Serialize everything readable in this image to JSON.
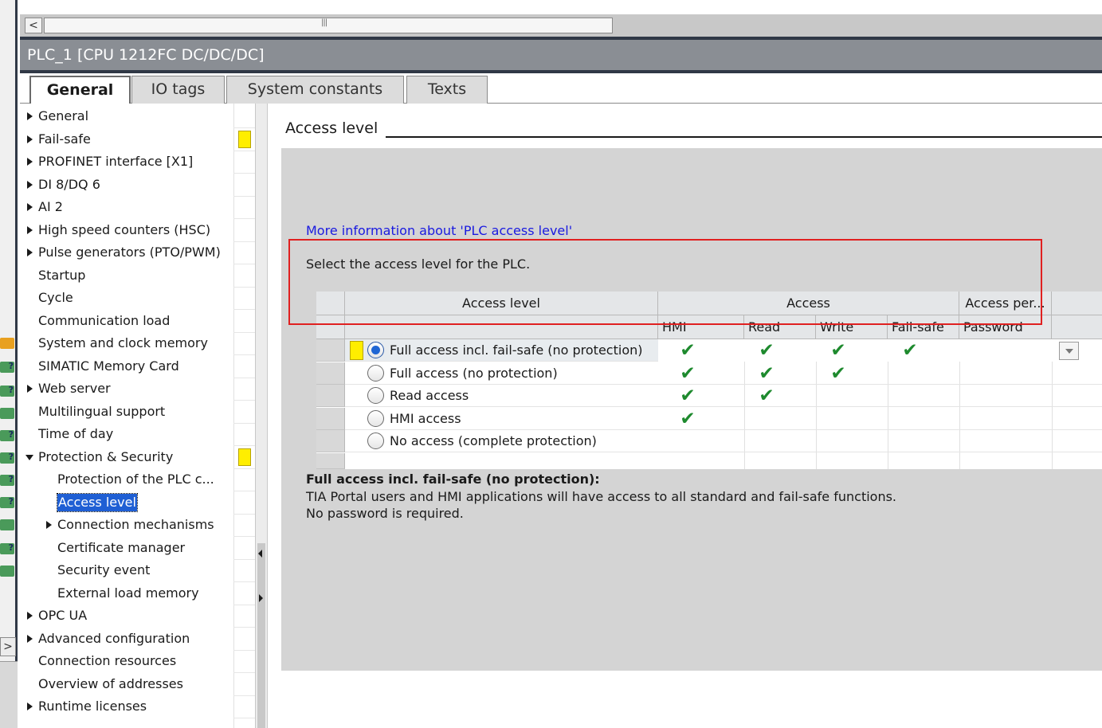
{
  "window": {
    "title": "PLC_1 [CPU 1212FC DC/DC/DC]"
  },
  "tabs": [
    {
      "label": "General",
      "active": true
    },
    {
      "label": "IO tags",
      "active": false
    },
    {
      "label": "System constants",
      "active": false
    },
    {
      "label": "Texts",
      "active": false
    }
  ],
  "nav": {
    "items": [
      {
        "label": "General",
        "indent": 0,
        "expander": "right"
      },
      {
        "label": "Fail-safe",
        "indent": 0,
        "expander": "right",
        "flag": true
      },
      {
        "label": "PROFINET interface [X1]",
        "indent": 0,
        "expander": "right"
      },
      {
        "label": "DI 8/DQ 6",
        "indent": 0,
        "expander": "right"
      },
      {
        "label": "AI 2",
        "indent": 0,
        "expander": "right"
      },
      {
        "label": "High speed counters (HSC)",
        "indent": 0,
        "expander": "right"
      },
      {
        "label": "Pulse generators (PTO/PWM)",
        "indent": 0,
        "expander": "right"
      },
      {
        "label": "Startup",
        "indent": 0,
        "expander": "none"
      },
      {
        "label": "Cycle",
        "indent": 0,
        "expander": "none"
      },
      {
        "label": "Communication load",
        "indent": 0,
        "expander": "none"
      },
      {
        "label": "System and clock memory",
        "indent": 0,
        "expander": "none"
      },
      {
        "label": "SIMATIC Memory Card",
        "indent": 0,
        "expander": "none"
      },
      {
        "label": "Web server",
        "indent": 0,
        "expander": "right"
      },
      {
        "label": "Multilingual support",
        "indent": 0,
        "expander": "none"
      },
      {
        "label": "Time of day",
        "indent": 0,
        "expander": "none"
      },
      {
        "label": "Protection & Security",
        "indent": 0,
        "expander": "down",
        "flag": true
      },
      {
        "label": "Protection of the PLC c...",
        "indent": 1,
        "expander": "none"
      },
      {
        "label": "Access level",
        "indent": 1,
        "expander": "none",
        "selected": true
      },
      {
        "label": "Connection mechanisms",
        "indent": 1,
        "expander": "right"
      },
      {
        "label": "Certificate manager",
        "indent": 1,
        "expander": "none"
      },
      {
        "label": "Security event",
        "indent": 1,
        "expander": "none"
      },
      {
        "label": "External load memory",
        "indent": 1,
        "expander": "none"
      },
      {
        "label": "OPC UA",
        "indent": 0,
        "expander": "right"
      },
      {
        "label": "Advanced configuration",
        "indent": 0,
        "expander": "right"
      },
      {
        "label": "Connection resources",
        "indent": 0,
        "expander": "none"
      },
      {
        "label": "Overview of addresses",
        "indent": 0,
        "expander": "none"
      },
      {
        "label": "Runtime licenses",
        "indent": 0,
        "expander": "right"
      }
    ]
  },
  "content": {
    "section_title": "Access level",
    "info_link": "More information about 'PLC access level'",
    "instruction": "Select the access level for the PLC.",
    "grid": {
      "header_top": {
        "access_level": "Access level",
        "access": "Access",
        "access_permission": "Access per..."
      },
      "header_sub": {
        "hmi": "HMI",
        "read": "Read",
        "write": "Write",
        "failsafe": "Fail-safe",
        "password": "Password"
      },
      "rows": [
        {
          "label": "Full access incl. fail-safe (no protection)",
          "selected": true,
          "hmi": true,
          "read": true,
          "write": true,
          "failsafe": true
        },
        {
          "label": "Full access (no protection)",
          "selected": false,
          "hmi": true,
          "read": true,
          "write": true,
          "failsafe": false
        },
        {
          "label": "Read access",
          "selected": false,
          "hmi": true,
          "read": true,
          "write": false,
          "failsafe": false
        },
        {
          "label": "HMI access",
          "selected": false,
          "hmi": true,
          "read": false,
          "write": false,
          "failsafe": false
        },
        {
          "label": "No access (complete protection)",
          "selected": false,
          "hmi": false,
          "read": false,
          "write": false,
          "failsafe": false
        }
      ]
    },
    "description": {
      "title": "Full access incl. fail-safe (no protection):",
      "line1": "TIA Portal users and HMI applications will have access to all standard and fail-safe functions.",
      "line2": "No password is required."
    }
  },
  "colors": {
    "selection": "#1f5fd4",
    "check": "#1e8a2e",
    "warning_flag": "#ffee00",
    "highlight_box": "#e02020",
    "link": "#1a1ae0"
  }
}
